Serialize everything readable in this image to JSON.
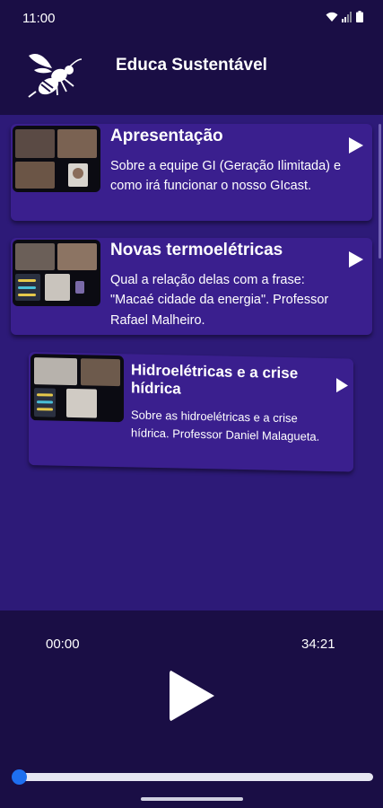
{
  "status_bar": {
    "time": "11:00"
  },
  "app": {
    "title": "Educa Sustentável",
    "logo": "wasp-logo-icon"
  },
  "episodes": [
    {
      "title": "Apresentação",
      "description": "Sobre a equipe GI (Geração Ilimitada) e como irá funcionar o nosso GIcast.",
      "thumbnail": "video-call-thumbnail",
      "action_icon": "play-icon"
    },
    {
      "title": "Novas termoelétricas",
      "description": "Qual a relação delas com a frase: \"Macaé cidade da energia\". Professor Rafael Malheiro.",
      "thumbnail": "video-call-thumbnail",
      "action_icon": "play-icon"
    },
    {
      "title": "Hidroelétricas e a crise hídrica",
      "description": "Sobre as hidroelétricas e a crise hídrica. Professor Daniel Malagueta.",
      "thumbnail": "video-call-thumbnail",
      "action_icon": "play-icon"
    }
  ],
  "player": {
    "current_time": "00:00",
    "total_time": "34:21",
    "progress": 0
  },
  "colors": {
    "background": "#1c0f4a",
    "list_background": "#2d1a78",
    "card": "#3a1f8e",
    "accent": "#1e6ff0"
  }
}
